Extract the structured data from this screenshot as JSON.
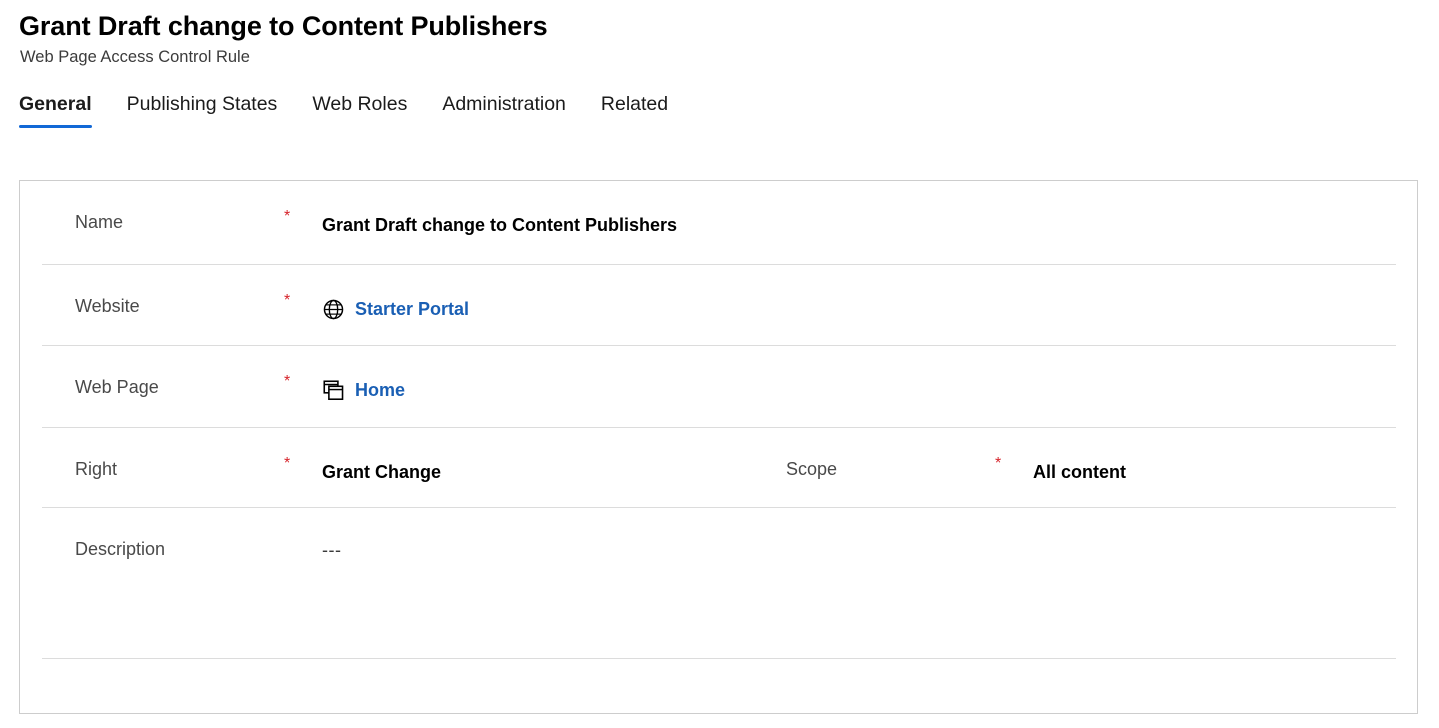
{
  "header": {
    "title": "Grant Draft change to Content Publishers",
    "subtitle": "Web Page Access Control Rule"
  },
  "tabs": [
    {
      "label": "General",
      "active": true
    },
    {
      "label": "Publishing States",
      "active": false
    },
    {
      "label": "Web Roles",
      "active": false
    },
    {
      "label": "Administration",
      "active": false
    },
    {
      "label": "Related",
      "active": false
    }
  ],
  "form": {
    "fields": {
      "name": {
        "label": "Name",
        "required": "*",
        "value": "Grant Draft change to Content Publishers"
      },
      "website": {
        "label": "Website",
        "required": "*",
        "value": "Starter Portal",
        "icon": "globe-icon"
      },
      "webpage": {
        "label": "Web Page",
        "required": "*",
        "value": "Home",
        "icon": "web-page-stack-icon"
      },
      "right": {
        "label": "Right",
        "required": "*",
        "value": "Grant Change"
      },
      "scope": {
        "label": "Scope",
        "required": "*",
        "value": "All content"
      },
      "description": {
        "label": "Description",
        "required": "",
        "value": "---"
      }
    }
  },
  "colors": {
    "accent": "#1268d6",
    "link": "#1a5fb4",
    "required": "#d6232a",
    "label": "#494949",
    "card_border": "#cdcdcd",
    "row_separator": "#dcdcdc"
  }
}
